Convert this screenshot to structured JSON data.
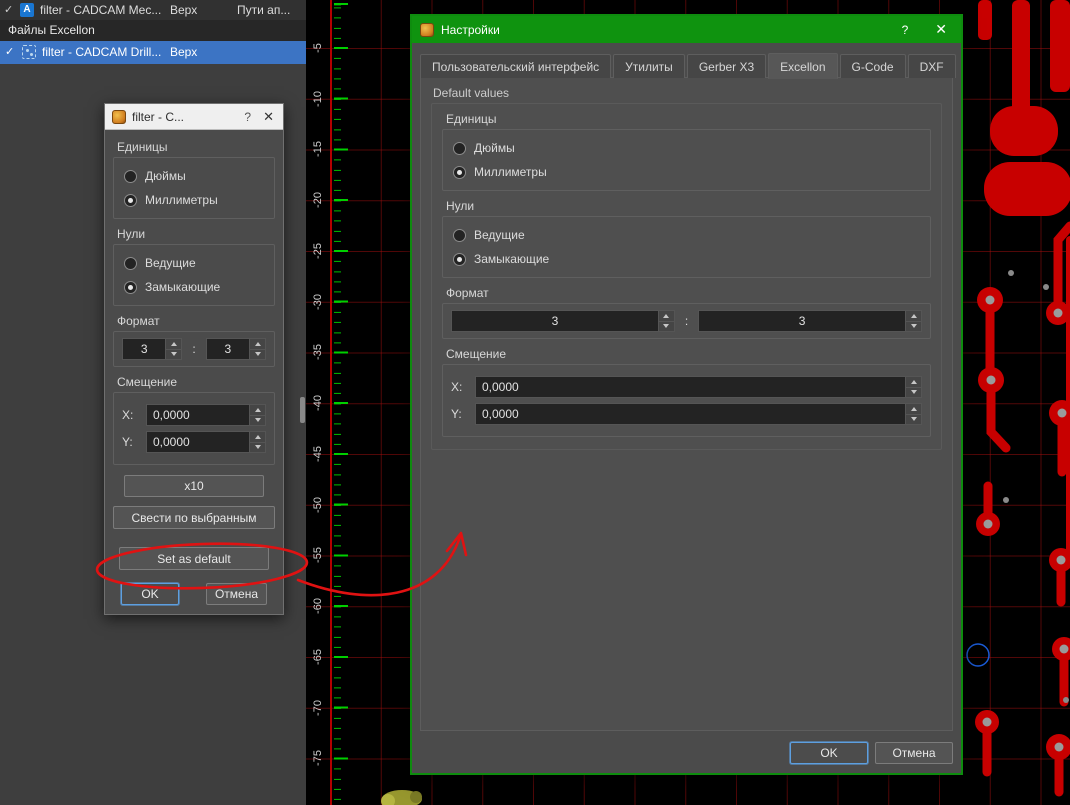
{
  "colors": {
    "titlebar_green": "#0f930f",
    "selection_blue": "#3c74c4",
    "annotation_red": "#e01212",
    "pcb_red": "#c80000",
    "ruler_tick_green": "#00c000"
  },
  "left_panel": {
    "gerber_row": {
      "check": "✓",
      "icon_letter": "A",
      "name": "filter - CADCAM Mec...",
      "layer": "Верх",
      "extra": "Пути ап..."
    },
    "section_header": "Файлы Excellon",
    "drill_row": {
      "check": "✓",
      "name": "filter - CADCAM Drill...",
      "layer": "Верх"
    }
  },
  "ruler": {
    "labels": [
      "-5",
      "-10",
      "-15",
      "-20",
      "-25",
      "-30",
      "-35",
      "-40",
      "-45",
      "-50",
      "-55",
      "-60",
      "-65",
      "-70",
      "-75"
    ]
  },
  "small_dialog": {
    "title": "filter - C...",
    "help_button": "?",
    "close_button": "✕",
    "units": {
      "label": "Единицы",
      "options": [
        {
          "label": "Дюймы",
          "selected": false
        },
        {
          "label": "Миллиметры",
          "selected": true
        }
      ]
    },
    "zeros": {
      "label": "Нули",
      "options": [
        {
          "label": "Ведущие",
          "selected": false
        },
        {
          "label": "Замыкающие",
          "selected": true
        }
      ]
    },
    "format": {
      "label": "Формат",
      "value_a": "3",
      "separator": ":",
      "value_b": "3"
    },
    "offset": {
      "label": "Смещение",
      "x_label": "X:",
      "x_value": "0,0000",
      "y_label": "Y:",
      "y_value": "0,0000"
    },
    "x10_button": "x10",
    "apply_selected_button": "Свести по выбранным",
    "set_default_button": "Set as default",
    "ok_button": "OK",
    "cancel_button": "Отмена"
  },
  "settings_dialog": {
    "title": "Настройки",
    "help_button": "?",
    "close_button": "✕",
    "tabs": [
      {
        "label": "Пользовательский интерфейс",
        "active": false
      },
      {
        "label": "Утилиты",
        "active": false
      },
      {
        "label": "Gerber X3",
        "active": false
      },
      {
        "label": "Excellon",
        "active": true
      },
      {
        "label": "G-Code",
        "active": false
      },
      {
        "label": "DXF",
        "active": false
      }
    ],
    "section_label": "Default values",
    "units": {
      "label": "Единицы",
      "options": [
        {
          "label": "Дюймы",
          "selected": false
        },
        {
          "label": "Миллиметры",
          "selected": true
        }
      ]
    },
    "zeros": {
      "label": "Нули",
      "options": [
        {
          "label": "Ведущие",
          "selected": false
        },
        {
          "label": "Замыкающие",
          "selected": true
        }
      ]
    },
    "format": {
      "label": "Формат",
      "value_a": "3",
      "separator": ":",
      "value_b": "3"
    },
    "offset": {
      "label": "Смещение",
      "x_label": "X:",
      "x_value": "0,0000",
      "y_label": "Y:",
      "y_value": "0,0000"
    },
    "ok_button": "OK",
    "cancel_button": "Отмена"
  }
}
